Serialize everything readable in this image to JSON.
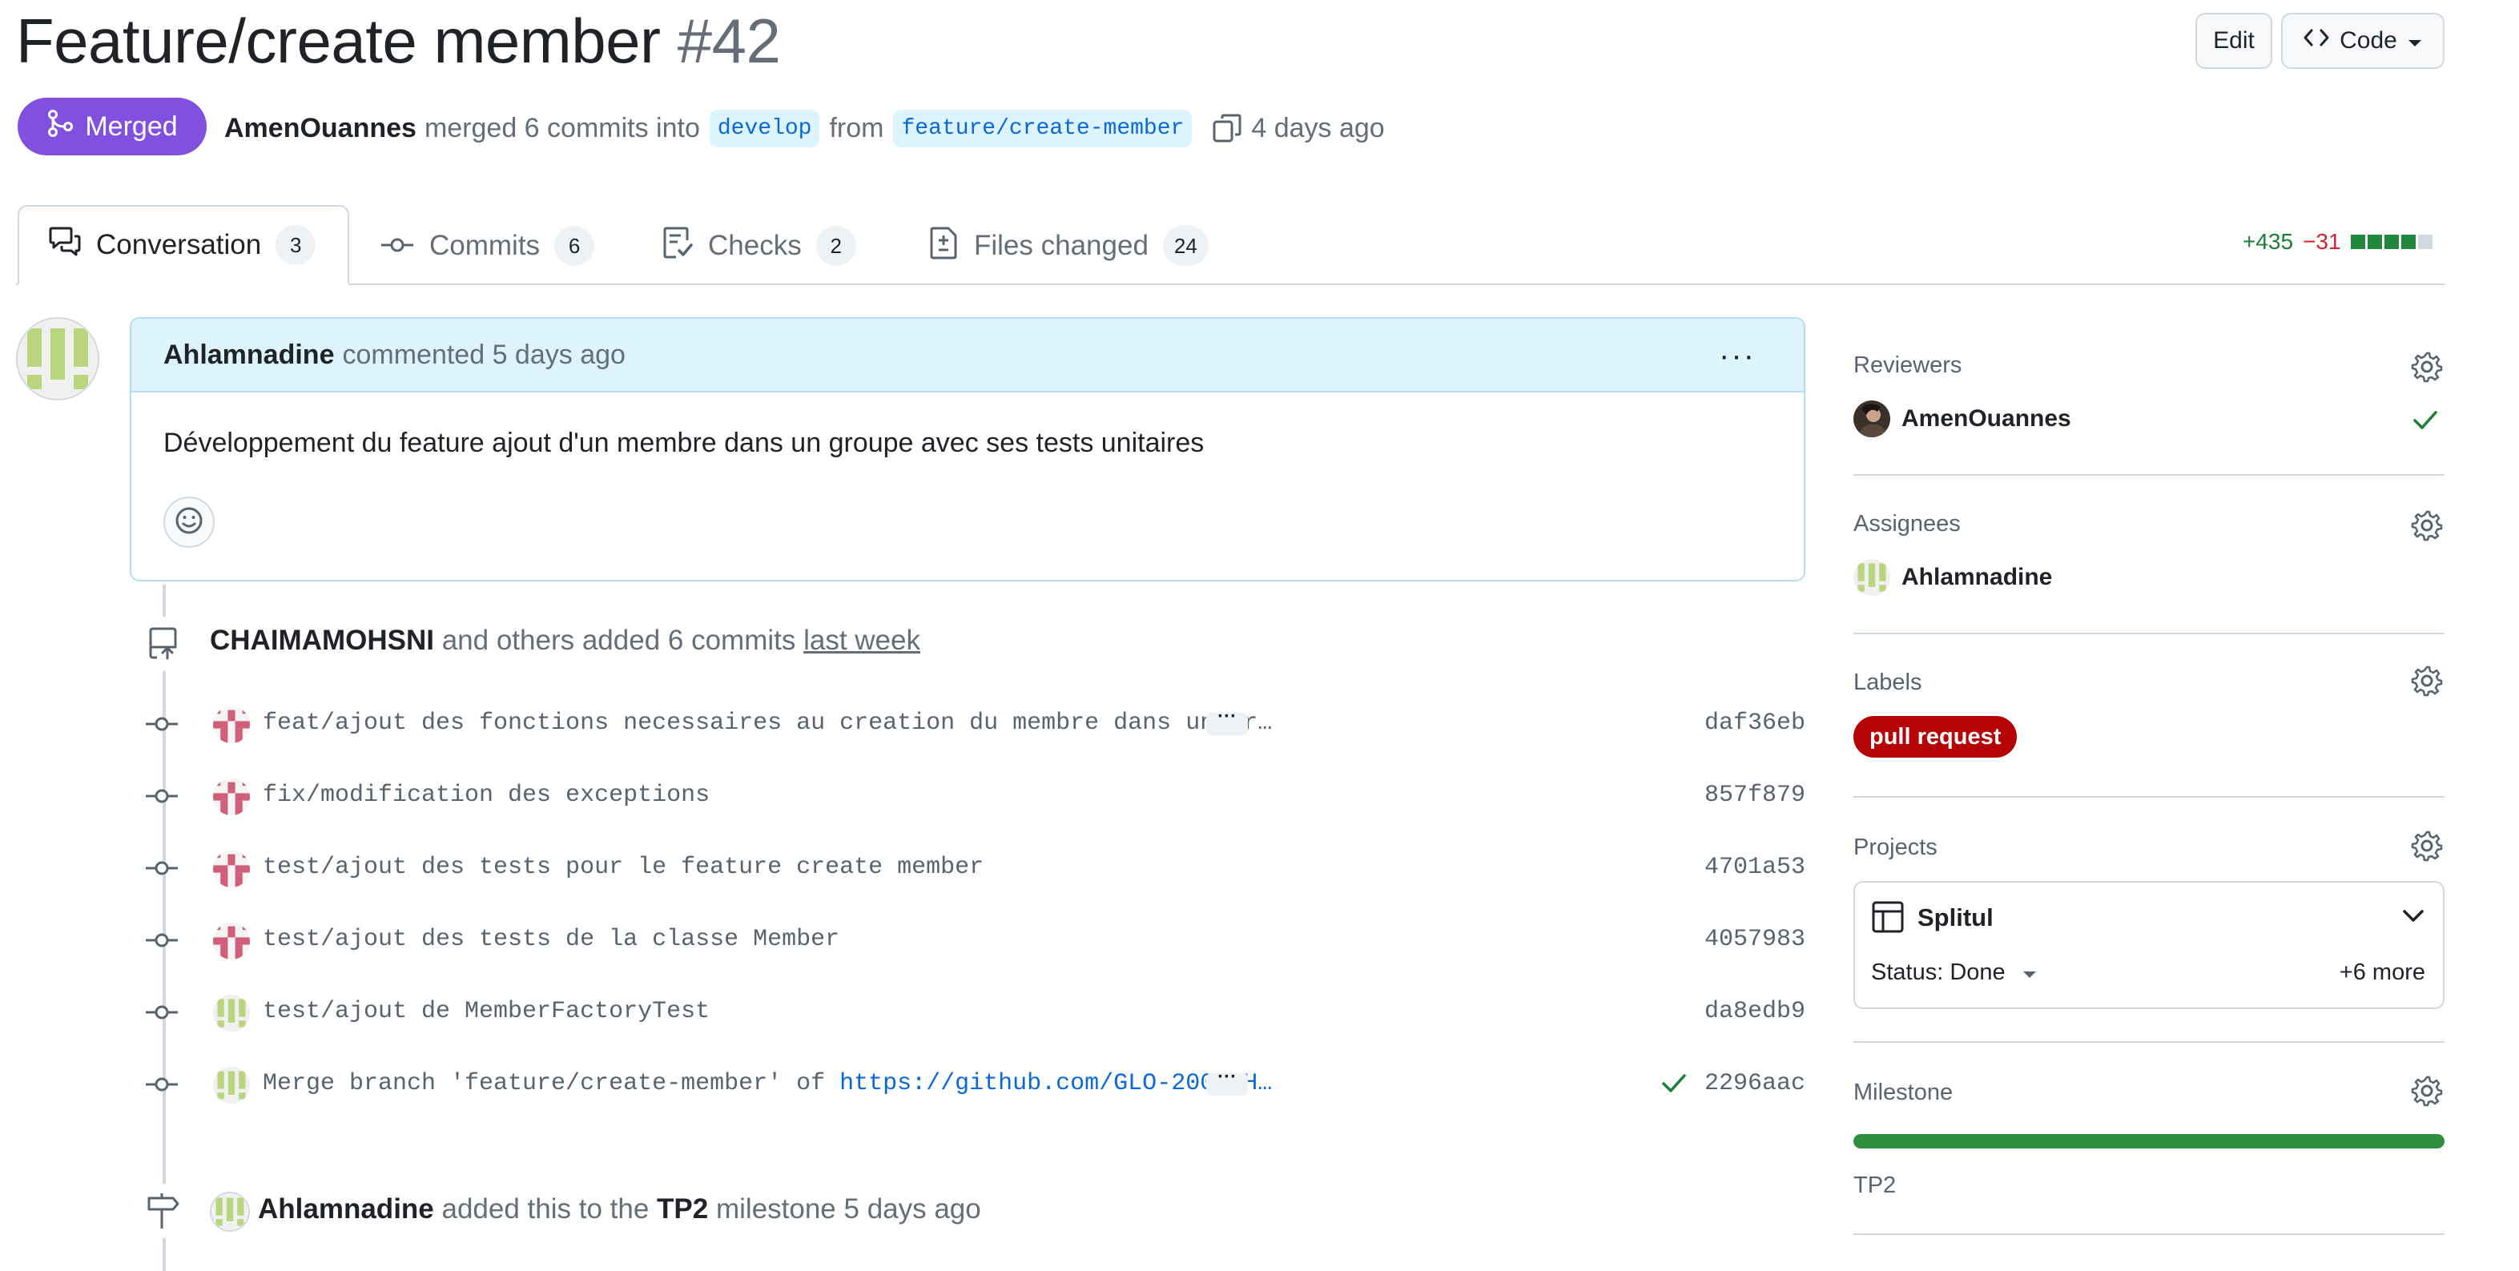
{
  "header": {
    "title": "Feature/create member",
    "number": "#42",
    "edit_label": "Edit",
    "code_label": "Code"
  },
  "meta": {
    "status": "Merged",
    "author": "AmenOuannes",
    "merged_text": "merged 6 commits into",
    "base_branch": "develop",
    "from_text": "from",
    "head_branch": "feature/create-member",
    "time": "4 days ago"
  },
  "tabs": [
    {
      "label": "Conversation",
      "count": "3"
    },
    {
      "label": "Commits",
      "count": "6"
    },
    {
      "label": "Checks",
      "count": "2"
    },
    {
      "label": "Files changed",
      "count": "24"
    }
  ],
  "diffstat": {
    "additions": "+435",
    "deletions": "−31"
  },
  "comment": {
    "author": "Ahlamnadine",
    "action": "commented 5 days ago",
    "body": "Développement du feature ajout d'un membre dans un groupe avec ses tests unitaires"
  },
  "commits_event": {
    "author": "CHAIMAMOHSNI",
    "text": "and others added 6 commits",
    "time": "last week"
  },
  "commits": [
    {
      "message": "feat/ajout des fonctions necessaires au creation du membre dans un gr…",
      "sha": "daf36eb"
    },
    {
      "message": "fix/modification des exceptions",
      "sha": "857f879"
    },
    {
      "message": "test/ajout des tests pour le feature create member",
      "sha": "4701a53"
    },
    {
      "message": "test/ajout des tests de la classe Member",
      "sha": "4057983"
    },
    {
      "message": "test/ajout de MemberFactoryTest",
      "sha": "da8edb9"
    },
    {
      "message": "Merge branch 'feature/create-member' of ",
      "link": "https://github.com/GLO-2003-H…",
      "sha": "2296aac"
    }
  ],
  "milestone_event": {
    "author": "Ahlamnadine",
    "text_before": "added this to the",
    "milestone": "TP2",
    "text_after": "milestone 5 days ago"
  },
  "sidebar": {
    "reviewers": {
      "heading": "Reviewers",
      "name": "AmenOuannes"
    },
    "assignees": {
      "heading": "Assignees",
      "name": "Ahlamnadine"
    },
    "labels": {
      "heading": "Labels",
      "label": "pull request",
      "label_color": "#b60205"
    },
    "projects": {
      "heading": "Projects",
      "name": "Splitul",
      "status": "Status: Done",
      "more": "+6 more"
    },
    "milestone": {
      "heading": "Milestone",
      "name": "TP2",
      "progress": 1.0
    }
  },
  "colors": {
    "merged": "#8250df",
    "link": "#0969da",
    "success": "#1a7f37",
    "danger": "#d1242f"
  }
}
